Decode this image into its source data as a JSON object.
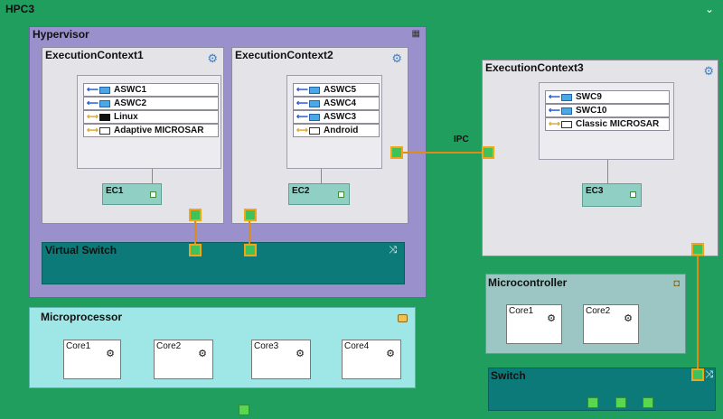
{
  "hpc": {
    "title": "HPC3"
  },
  "hypervisor": {
    "title": "Hypervisor"
  },
  "contexts": [
    {
      "title": "ExecutionContext1",
      "items": [
        {
          "label": "ASWC1",
          "kind": "app"
        },
        {
          "label": "ASWC2",
          "kind": "app"
        },
        {
          "label": "Linux",
          "kind": "os"
        },
        {
          "label": "Adaptive MICROSAR",
          "kind": "middleware"
        }
      ],
      "ec": "EC1"
    },
    {
      "title": "ExecutionContext2",
      "items": [
        {
          "label": "ASWC5",
          "kind": "app"
        },
        {
          "label": "ASWC4",
          "kind": "app"
        },
        {
          "label": "ASWC3",
          "kind": "app"
        },
        {
          "label": "Android",
          "kind": "middleware"
        }
      ],
      "ec": "EC2"
    },
    {
      "title": "ExecutionContext3",
      "items": [
        {
          "label": "SWC9",
          "kind": "app"
        },
        {
          "label": "SWC10",
          "kind": "app"
        },
        {
          "label": "Classic MICROSAR",
          "kind": "middleware"
        }
      ],
      "ec": "EC3"
    }
  ],
  "ipc": {
    "label": "IPC"
  },
  "virtual_switch": {
    "title": "Virtual Switch"
  },
  "microprocessor": {
    "title": "Microprocessor",
    "cores": [
      "Core1",
      "Core2",
      "Core3",
      "Core4"
    ]
  },
  "microcontroller": {
    "title": "Microcontroller",
    "cores": [
      "Core1",
      "Core2"
    ]
  },
  "switch": {
    "title": "Switch"
  },
  "colors": {
    "background": "#1f9e5e",
    "hypervisor": "#9a90cc",
    "connector": "#e08a18",
    "switch": "#0b7a78"
  },
  "icons": {
    "settings": "gear-icon",
    "core": "cog-icon",
    "shuffle": "shuffle-icon",
    "chip": "chip-icon"
  }
}
